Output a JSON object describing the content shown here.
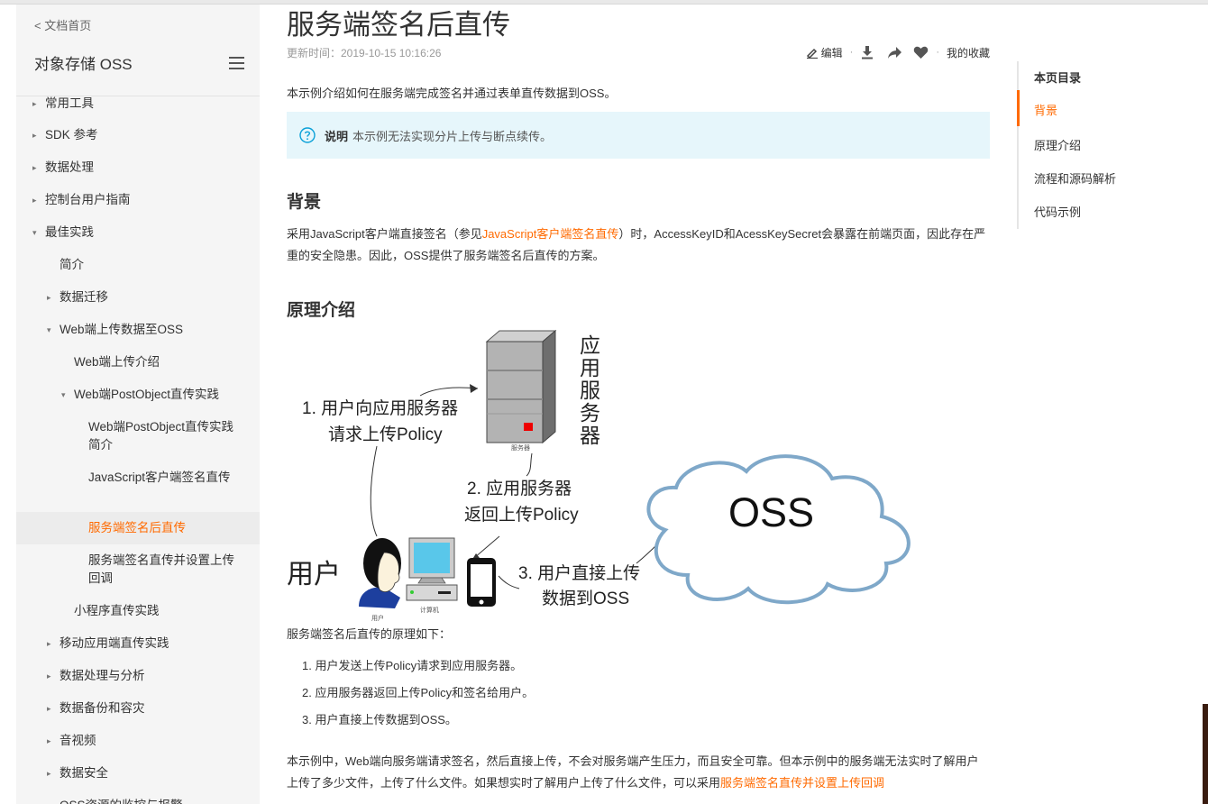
{
  "sidebar": {
    "back_link": "< 文档首页",
    "title": "对象存储 OSS",
    "menu_icon": "hamburger-menu-icon",
    "items": [
      {
        "label": "常用工具",
        "arrow": "▸",
        "level": 0
      },
      {
        "label": "SDK 参考",
        "arrow": "▸",
        "level": 0
      },
      {
        "label": "数据处理",
        "arrow": "▸",
        "level": 0
      },
      {
        "label": "控制台用户指南",
        "arrow": "▸",
        "level": 0
      },
      {
        "label": "最佳实践",
        "arrow": "▾",
        "level": 0
      },
      {
        "label": "简介",
        "arrow": "",
        "level": 1
      },
      {
        "label": "数据迁移",
        "arrow": "▸",
        "level": 1
      },
      {
        "label": "Web端上传数据至OSS",
        "arrow": "▾",
        "level": 1
      },
      {
        "label": "Web端上传介绍",
        "arrow": "",
        "level": 2
      },
      {
        "label": "Web端PostObject直传实践",
        "arrow": "▾",
        "level": 2
      },
      {
        "label": "Web端PostObject直传实践简介",
        "arrow": "",
        "level": 3
      },
      {
        "label": "JavaScript客户端签名直传",
        "arrow": "",
        "level": 3
      },
      {
        "label": "服务端签名后直传",
        "arrow": "",
        "level": 3,
        "active": true
      },
      {
        "label": "服务端签名直传并设置上传回调",
        "arrow": "",
        "level": 3
      },
      {
        "label": "小程序直传实践",
        "arrow": "",
        "level": 2
      },
      {
        "label": "移动应用端直传实践",
        "arrow": "▸",
        "level": 1
      },
      {
        "label": "数据处理与分析",
        "arrow": "▸",
        "level": 1
      },
      {
        "label": "数据备份和容灾",
        "arrow": "▸",
        "level": 1
      },
      {
        "label": "音视频",
        "arrow": "▸",
        "level": 1
      },
      {
        "label": "数据安全",
        "arrow": "▸",
        "level": 1
      },
      {
        "label": "OSS资源的监控与报警",
        "arrow": "",
        "level": 1
      }
    ]
  },
  "main": {
    "title": "服务端签名后直传",
    "updated": "更新时间：2019-10-15 10:16:26",
    "toolbar": {
      "edit_label": "编辑",
      "collect_label": "我的收藏",
      "sep": "·"
    },
    "intro": "本示例介绍如何在服务端完成签名并通过表单直传数据到OSS。",
    "note": {
      "label": "说明",
      "text": "本示例无法实现分片上传与断点续传。"
    },
    "background": {
      "heading": "背景",
      "text_before": "采用JavaScript客户端直接签名（参见",
      "link": "JavaScript客户端签名直传",
      "text_after": "）时，AccessKeyID和AcessKeySecret会暴露在前端页面，因此存在严重的安全隐患。因此，OSS提供了服务端签名后直传的方案。"
    },
    "principle": {
      "heading": "原理介绍",
      "diagram": {
        "server_label": "应用服务器",
        "server_caption": "服务器",
        "step1_line1": "1. 用户向应用服务器",
        "step1_line2": "请求上传Policy",
        "step2_line1": "2. 应用服务器",
        "step2_line2": "返回上传Policy",
        "step3_line1": "3. 用户直接上传",
        "step3_line2": "数据到OSS",
        "oss_label": "OSS",
        "user_label": "用户",
        "user_caption": "用户",
        "computer_caption": "计算机"
      },
      "steps_intro": "服务端签名后直传的原理如下：",
      "steps": [
        "1. 用户发送上传Policy请求到应用服务器。",
        "2. 应用服务器返回上传Policy和签名给用户。",
        "3. 用户直接上传数据到OSS。"
      ]
    },
    "bottom": {
      "text_before": "本示例中，Web端向服务端请求签名，然后直接上传，不会对服务端产生压力，而且安全可靠。但本示例中的服务端无法实时了解用户上传了多少文件，上传了什么文件。如果想实时了解用户上传了什么文件，可以采用",
      "link": "服务端签名直传并设置上传回调"
    }
  },
  "toc": {
    "title": "本页目录",
    "items": [
      "背景",
      "原理介绍",
      "流程和源码解析",
      "代码示例"
    ]
  },
  "colors": {
    "accent": "#ff6a00",
    "note_bg": "#e6f6fb",
    "sidebar_bg": "#f5f5f5",
    "cloud_stroke": "#7fa8c9"
  }
}
